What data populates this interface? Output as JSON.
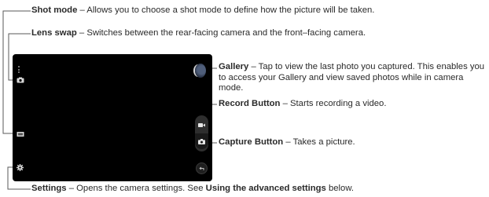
{
  "callouts": {
    "shot_mode": {
      "term": "Shot mode",
      "desc": " – Allows you to choose a shot mode to define how the picture will be taken."
    },
    "lens_swap": {
      "term": "Lens swap",
      "desc": " – Switches between the rear-facing camera and the front–facing camera."
    },
    "gallery": {
      "term": "Gallery",
      "desc": " – Tap to view the last photo you captured. This enables you to access your Gallery and view saved photos while in camera mode."
    },
    "record": {
      "term": "Record Button",
      "desc": " – Starts recording a video."
    },
    "capture": {
      "term": "Capture Button",
      "desc": " – Takes a picture."
    },
    "settings": {
      "term": "Settings",
      "desc_pre": " – Opens the camera settings. See ",
      "link": "Using the advanced settings",
      "desc_post": " below."
    }
  },
  "icons": {
    "menu": "more-vert-icon",
    "lens_swap": "camera-switch-icon",
    "shot_mode": "mode-icon",
    "settings": "gear-icon",
    "record": "video-camera-icon",
    "capture": "camera-icon",
    "back": "back-icon",
    "gallery": "gallery-thumbnail"
  },
  "colors": {
    "line": "#5a5a5a",
    "screen": "#000000",
    "text": "#2a2a2a"
  }
}
